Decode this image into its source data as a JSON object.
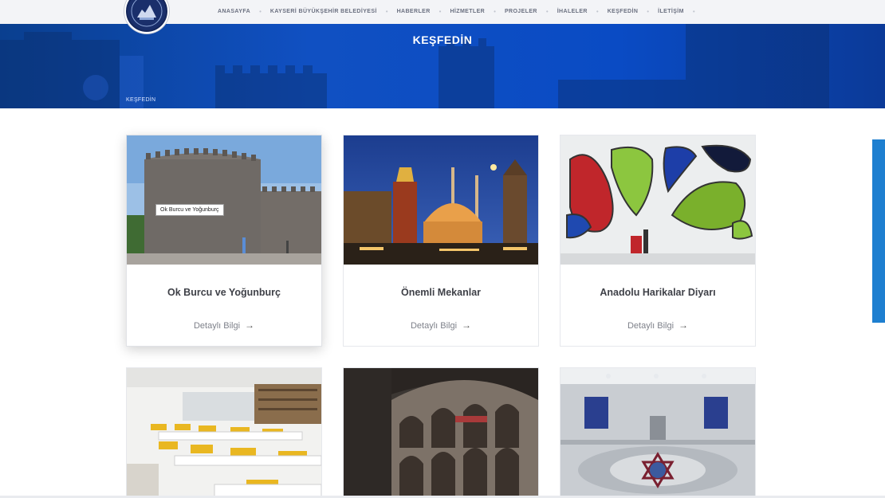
{
  "nav": {
    "logo": "Kayseri Büyükşehir Belediyesi",
    "items": [
      {
        "label": "ANASAYFA"
      },
      {
        "label": "KAYSERİ BÜYÜKŞEHİR BELEDİYESİ"
      },
      {
        "label": "HABERLER"
      },
      {
        "label": "HİZMETLER"
      },
      {
        "label": "PROJELER"
      },
      {
        "label": "İHALELER"
      },
      {
        "label": "KEŞFEDİN"
      },
      {
        "label": "İLETİŞİM"
      }
    ],
    "separator": "•"
  },
  "hero": {
    "title": "KEŞFEDİN",
    "breadcrumb": "KEŞFEDİN"
  },
  "cards": [
    {
      "title": "Ok Burcu ve Yoğunburç",
      "link": "Detaylı Bilgi",
      "image": "castle-photo",
      "tooltip": "Ok Burcu ve Yoğunburç"
    },
    {
      "title": "Önemli Mekanlar",
      "link": "Detaylı Bilgi",
      "image": "city-night-photo"
    },
    {
      "title": "Anadolu Harikalar Diyarı",
      "link": "Detaylı Bilgi",
      "image": "colorful-glass-wall-photo"
    },
    {
      "image": "library-photo"
    },
    {
      "image": "historic-inn-photo"
    },
    {
      "image": "turkish-bath-photo"
    }
  ],
  "colors": {
    "accent": "#1050c2",
    "hero_dark": "#0a3f8f",
    "side_tab": "#1e7fd0",
    "title_text": "#3f4148"
  },
  "icons": {
    "arrow": "arrow-right-icon"
  }
}
